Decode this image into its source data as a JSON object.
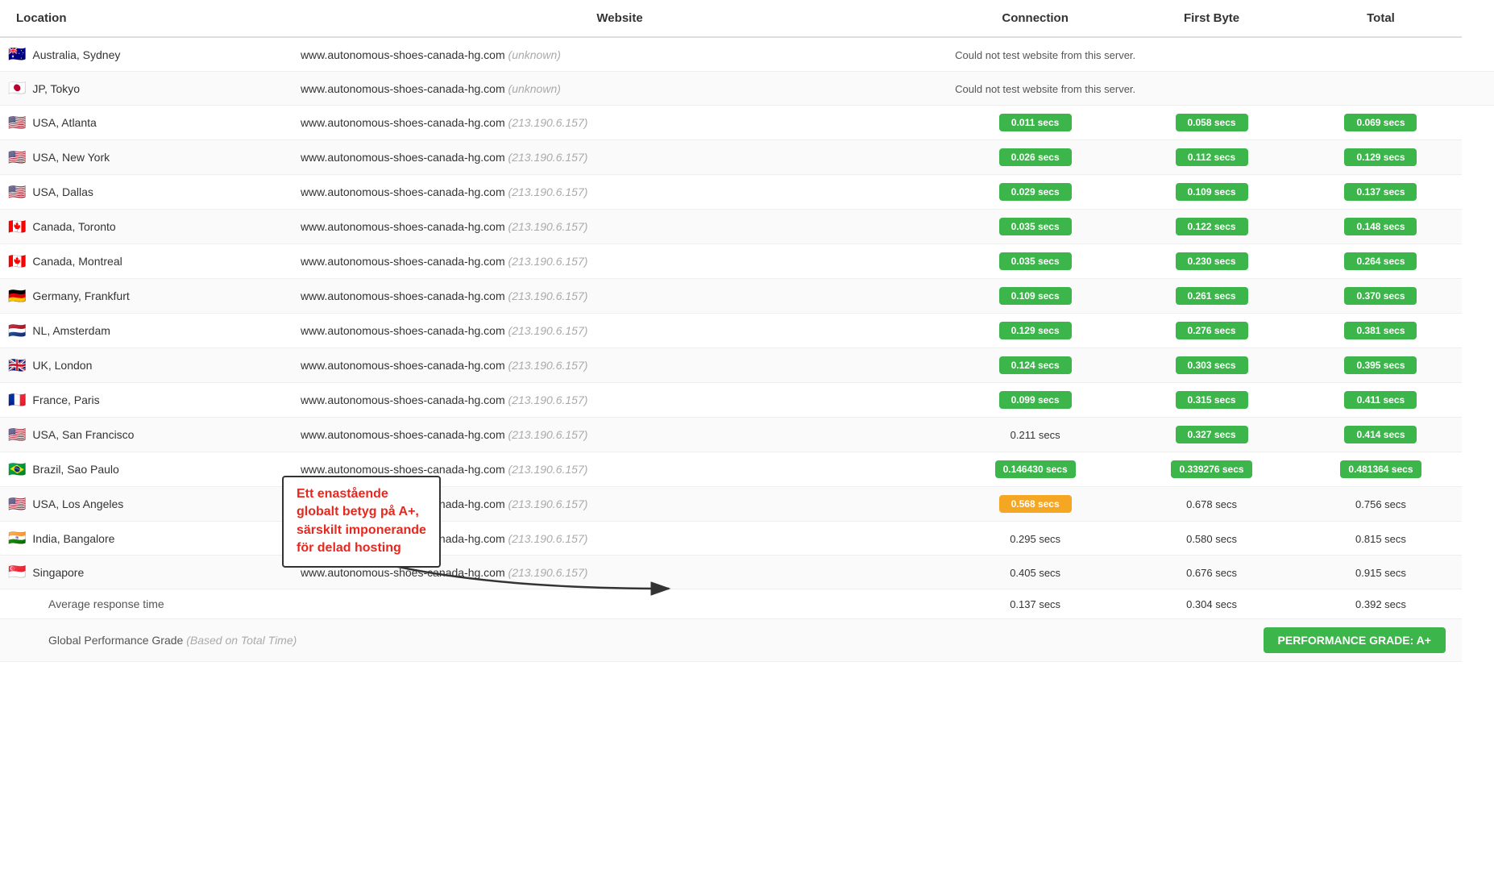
{
  "table": {
    "headers": {
      "location": "Location",
      "website": "Website",
      "connection": "Connection",
      "firstbyte": "First Byte",
      "total": "Total"
    },
    "rows": [
      {
        "flag": "🇦🇺",
        "location": "Australia, Sydney",
        "domain": "www.autonomous-shoes-canada-hg.com",
        "ip": "(unknown)",
        "connection": {
          "value": "Could not test website from this server.",
          "type": "error"
        },
        "firstbyte": {
          "value": "",
          "type": "empty"
        },
        "total": {
          "value": "",
          "type": "empty"
        }
      },
      {
        "flag": "🇯🇵",
        "location": "JP, Tokyo",
        "domain": "www.autonomous-shoes-canada-hg.com",
        "ip": "(unknown)",
        "connection": {
          "value": "Could not test website from this server.",
          "type": "error"
        },
        "firstbyte": {
          "value": "",
          "type": "empty"
        },
        "total": {
          "value": "",
          "type": "empty"
        }
      },
      {
        "flag": "🇺🇸",
        "location": "USA, Atlanta",
        "domain": "www.autonomous-shoes-canada-hg.com",
        "ip": "(213.190.6.157)",
        "connection": {
          "value": "0.011 secs",
          "type": "green"
        },
        "firstbyte": {
          "value": "0.058 secs",
          "type": "green"
        },
        "total": {
          "value": "0.069 secs",
          "type": "green"
        }
      },
      {
        "flag": "🇺🇸",
        "location": "USA, New York",
        "domain": "www.autonomous-shoes-canada-hg.com",
        "ip": "(213.190.6.157)",
        "connection": {
          "value": "0.026 secs",
          "type": "green"
        },
        "firstbyte": {
          "value": "0.112 secs",
          "type": "green"
        },
        "total": {
          "value": "0.129 secs",
          "type": "green"
        }
      },
      {
        "flag": "🇺🇸",
        "location": "USA, Dallas",
        "domain": "www.autonomous-shoes-canada-hg.com",
        "ip": "(213.190.6.157)",
        "connection": {
          "value": "0.029 secs",
          "type": "green"
        },
        "firstbyte": {
          "value": "0.109 secs",
          "type": "green"
        },
        "total": {
          "value": "0.137 secs",
          "type": "green"
        }
      },
      {
        "flag": "🇨🇦",
        "location": "Canada, Toronto",
        "domain": "www.autonomous-shoes-canada-hg.com",
        "ip": "(213.190.6.157)",
        "connection": {
          "value": "0.035 secs",
          "type": "green"
        },
        "firstbyte": {
          "value": "0.122 secs",
          "type": "green"
        },
        "total": {
          "value": "0.148 secs",
          "type": "green"
        }
      },
      {
        "flag": "🇨🇦",
        "location": "Canada, Montreal",
        "domain": "www.autonomous-shoes-canada-hg.com",
        "ip": "(213.190.6.157)",
        "connection": {
          "value": "0.035 secs",
          "type": "green"
        },
        "firstbyte": {
          "value": "0.230 secs",
          "type": "green"
        },
        "total": {
          "value": "0.264 secs",
          "type": "green"
        }
      },
      {
        "flag": "🇩🇪",
        "location": "Germany, Frankfurt",
        "domain": "www.autonomous-shoes-canada-hg.com",
        "ip": "(213.190.6.157)",
        "connection": {
          "value": "0.109 secs",
          "type": "green"
        },
        "firstbyte": {
          "value": "0.261 secs",
          "type": "green"
        },
        "total": {
          "value": "0.370 secs",
          "type": "green"
        }
      },
      {
        "flag": "🇳🇱",
        "location": "NL, Amsterdam",
        "domain": "www.autonomous-shoes-canada-hg.com",
        "ip": "(213.190.6.157)",
        "connection": {
          "value": "0.129 secs",
          "type": "green"
        },
        "firstbyte": {
          "value": "0.276 secs",
          "type": "green"
        },
        "total": {
          "value": "0.381 secs",
          "type": "green"
        }
      },
      {
        "flag": "🇬🇧",
        "location": "UK, London",
        "domain": "www.autonomous-shoes-canada-hg.com",
        "ip": "(213.190.6.157)",
        "connection": {
          "value": "0.124 secs",
          "type": "green"
        },
        "firstbyte": {
          "value": "0.303 secs",
          "type": "green"
        },
        "total": {
          "value": "0.395 secs",
          "type": "green"
        }
      },
      {
        "flag": "🇫🇷",
        "location": "France, Paris",
        "domain": "www.autonomous-shoes-canada-hg.com",
        "ip": "(213.190.6.157)",
        "connection": {
          "value": "0.099 secs",
          "type": "green"
        },
        "firstbyte": {
          "value": "0.315 secs",
          "type": "green"
        },
        "total": {
          "value": "0.411 secs",
          "type": "green"
        }
      },
      {
        "flag": "🇺🇸",
        "location": "USA, San Francisco",
        "domain": "www.autonomous-shoes-canada-hg.com",
        "ip": "(213.190.6.157)",
        "connection": {
          "value": "0.211 secs",
          "type": "plain"
        },
        "firstbyte": {
          "value": "0.327 secs",
          "type": "green"
        },
        "total": {
          "value": "0.414 secs",
          "type": "green"
        }
      },
      {
        "flag": "🇧🇷",
        "location": "Brazil, Sao Paulo",
        "domain": "www.autonomous-shoes-canada-hg.com",
        "ip": "(213.190.6.157)",
        "connection": {
          "value": "0.146430 secs",
          "type": "green"
        },
        "firstbyte": {
          "value": "0.339276 secs",
          "type": "green"
        },
        "total": {
          "value": "0.481364 secs",
          "type": "green"
        }
      },
      {
        "flag": "🇺🇸",
        "location": "USA, Los Angeles",
        "domain": "www.autonomous-shoes-canada-hg.com",
        "ip": "(213.190.6.157)",
        "connection": {
          "value": "0.568 secs",
          "type": "orange"
        },
        "firstbyte": {
          "value": "0.678 secs",
          "type": "plain"
        },
        "total": {
          "value": "0.756 secs",
          "type": "plain"
        }
      },
      {
        "flag": "🇮🇳",
        "location": "India, Bangalore",
        "domain": "www.autonomous-shoes-canada-hg.com",
        "ip": "(213.190.6.157)",
        "connection": {
          "value": "0.295 secs",
          "type": "plain"
        },
        "firstbyte": {
          "value": "0.580 secs",
          "type": "plain"
        },
        "total": {
          "value": "0.815 secs",
          "type": "plain"
        }
      },
      {
        "flag": "🇸🇬",
        "location": "Singapore",
        "domain": "www.autonomous-shoes-canada-hg.com",
        "ip": "(213.190.6.157)",
        "connection": {
          "value": "0.405 secs",
          "type": "plain"
        },
        "firstbyte": {
          "value": "0.676 secs",
          "type": "plain"
        },
        "total": {
          "value": "0.915 secs",
          "type": "plain"
        }
      }
    ],
    "avg_row": {
      "label": "Average response time",
      "connection": "0.137 secs",
      "firstbyte": "0.304 secs",
      "total": "0.392 secs"
    },
    "grade_row": {
      "label": "Global Performance Grade",
      "label_suffix": "(Based on Total Time)",
      "badge": "PERFORMANCE GRADE: A+"
    }
  },
  "annotation": {
    "text_line1": "Ett enastående",
    "text_line2": "globalt betyg på A+,",
    "text_line3": "särskilt imponerande",
    "text_line4": "för delad hosting"
  }
}
